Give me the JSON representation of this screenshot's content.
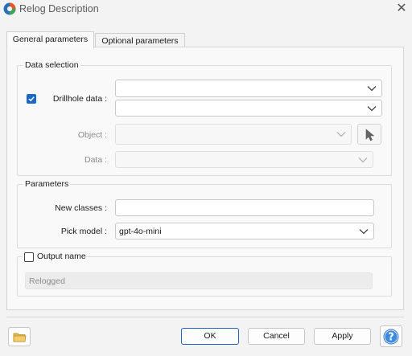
{
  "window": {
    "title": "Relog Description",
    "close_label": "✕"
  },
  "tabs": [
    {
      "label": "General parameters",
      "active": true
    },
    {
      "label": "Optional parameters",
      "active": false
    }
  ],
  "data_selection": {
    "legend": "Data selection",
    "drillhole_label": "Drillhole data :",
    "drillhole_checked": true,
    "drillhole_value_1": "",
    "drillhole_value_2": "",
    "object_label": "Object :",
    "object_value": "",
    "data_label": "Data :",
    "data_value": ""
  },
  "parameters": {
    "legend": "Parameters",
    "new_classes_label": "New classes :",
    "new_classes_value": "",
    "pick_model_label": "Pick model :",
    "pick_model_value": "gpt-4o-mini"
  },
  "output": {
    "label": "Output name",
    "checked": false,
    "value": "Relogged"
  },
  "buttons": {
    "ok": "OK",
    "cancel": "Cancel",
    "apply": "Apply"
  },
  "colors": {
    "accent": "#1b67c7",
    "help_icon": "#2f7bd3",
    "folder_icon": "#e8b84a"
  }
}
